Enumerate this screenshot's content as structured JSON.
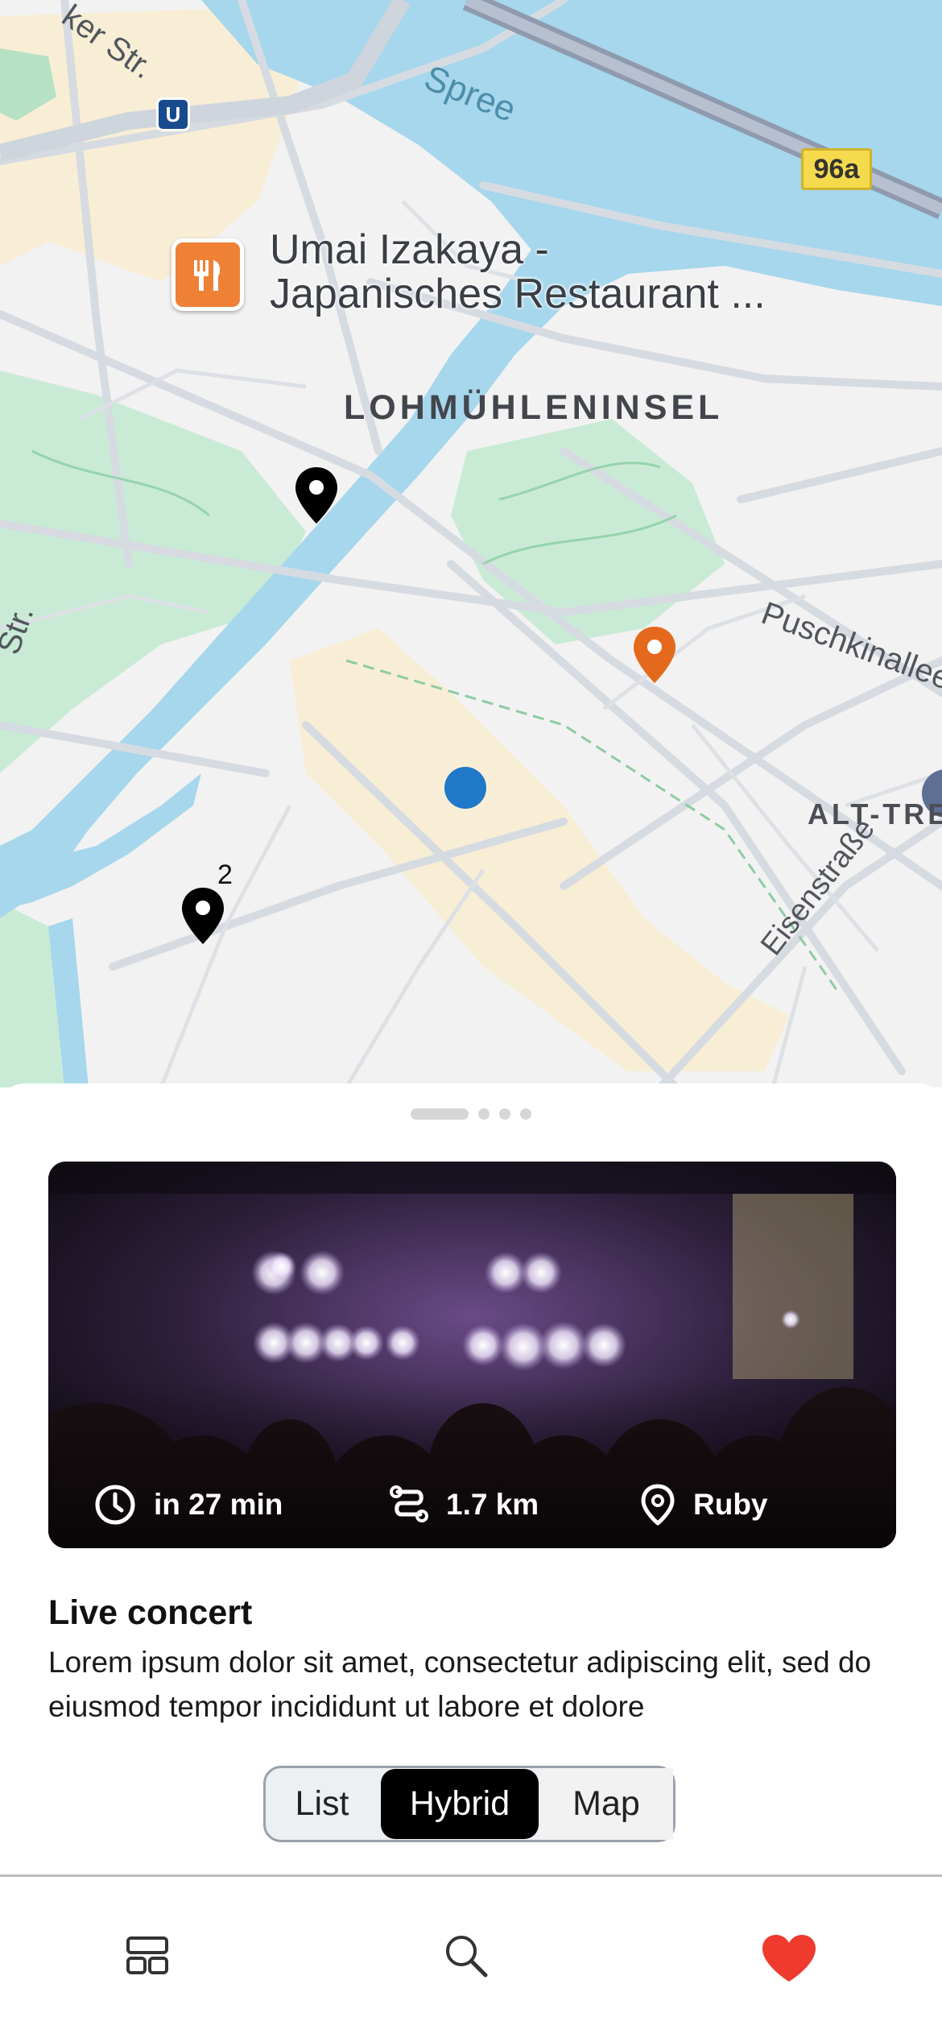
{
  "map": {
    "poi": {
      "name_line1": "Umai Izakaya -",
      "name_line2": "Japanisches Restaurant ...",
      "icon": "restaurant-icon",
      "color": "#ee8136"
    },
    "district_label": "LOHMÜHLENINSEL",
    "district_label_2": "ALT-TRE",
    "river_label": "Spree",
    "route_badge": "96a",
    "ubahn_label": "U",
    "streets": {
      "top_left": "ker Str.",
      "left": "Str.",
      "puschkin": "Puschkinallee",
      "eisen": "Eisenstraße"
    },
    "cluster_count": "2",
    "colors": {
      "water": "#a6d7ec",
      "park": "#c9ebd5",
      "road": "#d6dbe2",
      "user_location": "#1f78c8",
      "pin_black": "#000000",
      "pin_orange": "#e4691d"
    }
  },
  "sheet": {
    "pager": {
      "pages": 4,
      "active": 0
    },
    "event": {
      "time": "in 27 min",
      "distance": "1.7 km",
      "location": "Ruby",
      "title": "Live concert",
      "description": "Lorem ipsum dolor sit amet, consectetur adipiscing elit, sed do eiusmod tempor incididunt ut labore et dolore"
    },
    "view_toggle": {
      "options": [
        "List",
        "Hybrid",
        "Map"
      ],
      "selected": "Hybrid"
    }
  },
  "tabbar": {
    "items": [
      "layout-icon",
      "search-icon",
      "heart-icon"
    ],
    "active_color": "#ee3b2e"
  }
}
